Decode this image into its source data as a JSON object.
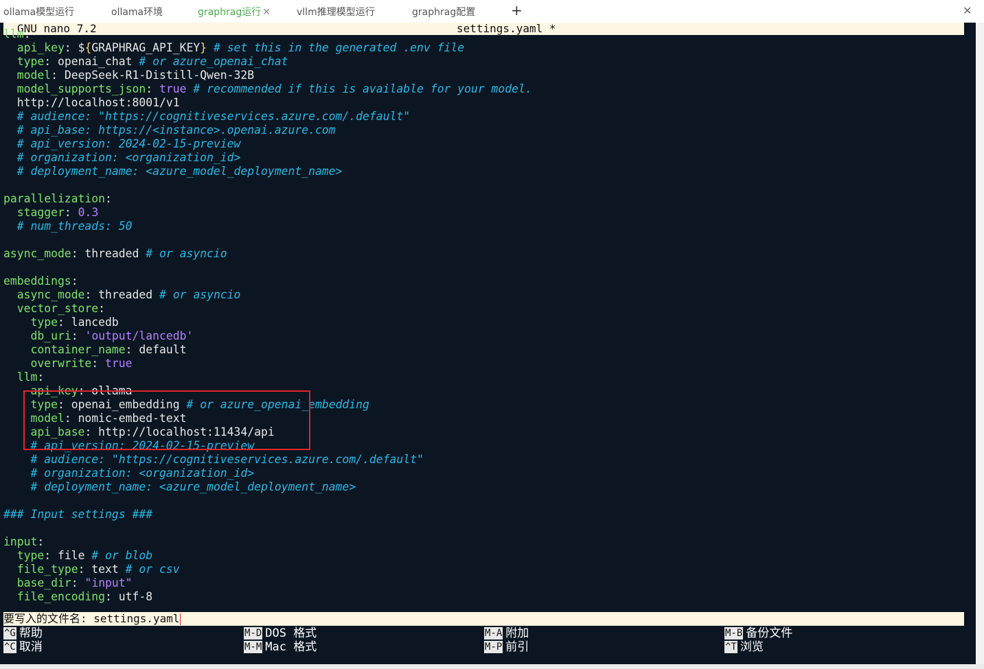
{
  "tabs": [
    {
      "label": "ollama模型运行",
      "active": false
    },
    {
      "label": "ollama环境",
      "active": false
    },
    {
      "label": "graphrag运行",
      "active": true,
      "close": "✕"
    },
    {
      "label": "vllm推理模型运行",
      "active": false
    },
    {
      "label": "graphrag配置",
      "active": false
    }
  ],
  "new_tab_label": "+",
  "window_close": "✕",
  "nano": {
    "version": "GNU nano 7.2",
    "filename": "settings.yaml *"
  },
  "editor_lines": [
    [
      {
        "t": "llm",
        "c": "k"
      },
      {
        "t": ":"
      }
    ],
    [
      {
        "t": "  "
      },
      {
        "t": "api_key",
        "c": "k"
      },
      {
        "t": ": $"
      },
      {
        "t": "{",
        "c": "p"
      },
      {
        "t": "GRAPHRAG_API_KEY"
      },
      {
        "t": "}",
        "c": "p"
      },
      {
        "t": " "
      },
      {
        "t": "# set this in the generated .env file",
        "c": "c"
      }
    ],
    [
      {
        "t": "  "
      },
      {
        "t": "type",
        "c": "k"
      },
      {
        "t": ": openai_chat "
      },
      {
        "t": "# or azure_openai_chat",
        "c": "c"
      }
    ],
    [
      {
        "t": "  "
      },
      {
        "t": "model",
        "c": "k"
      },
      {
        "t": ": DeepSeek-R1-Distill-Qwen-32B"
      }
    ],
    [
      {
        "t": "  "
      },
      {
        "t": "model_supports_json",
        "c": "k"
      },
      {
        "t": ": "
      },
      {
        "t": "true",
        "c": "v"
      },
      {
        "t": " "
      },
      {
        "t": "# recommended if this is available for your model.",
        "c": "c"
      }
    ],
    [
      {
        "t": "  http://localhost:8001/v1"
      }
    ],
    [
      {
        "t": "  "
      },
      {
        "t": "# audience: \"https://cognitiveservices.azure.com/.default\"",
        "c": "c"
      }
    ],
    [
      {
        "t": "  "
      },
      {
        "t": "# api_base: https://<instance>.openai.azure.com",
        "c": "c"
      }
    ],
    [
      {
        "t": "  "
      },
      {
        "t": "# api_version: 2024-02-15-preview",
        "c": "c"
      }
    ],
    [
      {
        "t": "  "
      },
      {
        "t": "# organization: <organization_id>",
        "c": "c"
      }
    ],
    [
      {
        "t": "  "
      },
      {
        "t": "# deployment_name: <azure_model_deployment_name>",
        "c": "c"
      }
    ],
    [],
    [
      {
        "t": "parallelization",
        "c": "k"
      },
      {
        "t": ":"
      }
    ],
    [
      {
        "t": "  "
      },
      {
        "t": "stagger",
        "c": "k"
      },
      {
        "t": ": "
      },
      {
        "t": "0.3",
        "c": "v"
      }
    ],
    [
      {
        "t": "  "
      },
      {
        "t": "# num_threads: 50",
        "c": "c"
      }
    ],
    [],
    [
      {
        "t": "async_mode",
        "c": "k"
      },
      {
        "t": ": threaded "
      },
      {
        "t": "# or asyncio",
        "c": "c"
      }
    ],
    [],
    [
      {
        "t": "embeddings",
        "c": "k"
      },
      {
        "t": ":"
      }
    ],
    [
      {
        "t": "  "
      },
      {
        "t": "async_mode",
        "c": "k"
      },
      {
        "t": ": threaded "
      },
      {
        "t": "# or asyncio",
        "c": "c"
      }
    ],
    [
      {
        "t": "  "
      },
      {
        "t": "vector_store",
        "c": "k"
      },
      {
        "t": ":"
      }
    ],
    [
      {
        "t": "    "
      },
      {
        "t": "type",
        "c": "k"
      },
      {
        "t": ": lancedb"
      }
    ],
    [
      {
        "t": "    "
      },
      {
        "t": "db_uri",
        "c": "k"
      },
      {
        "t": ": "
      },
      {
        "t": "'output/lancedb'",
        "c": "v"
      }
    ],
    [
      {
        "t": "    "
      },
      {
        "t": "container_name",
        "c": "k"
      },
      {
        "t": ": default"
      }
    ],
    [
      {
        "t": "    "
      },
      {
        "t": "overwrite",
        "c": "k"
      },
      {
        "t": ": "
      },
      {
        "t": "true",
        "c": "v"
      }
    ],
    [
      {
        "t": "  "
      },
      {
        "t": "llm",
        "c": "k"
      },
      {
        "t": ":"
      }
    ],
    [
      {
        "t": "    "
      },
      {
        "t": "api_key",
        "c": "k"
      },
      {
        "t": ": ollama"
      }
    ],
    [
      {
        "t": "    "
      },
      {
        "t": "type",
        "c": "k"
      },
      {
        "t": ": openai_embedding "
      },
      {
        "t": "# or azure_openai_embedding",
        "c": "c"
      }
    ],
    [
      {
        "t": "    "
      },
      {
        "t": "model",
        "c": "k"
      },
      {
        "t": ": nomic-embed-text"
      }
    ],
    [
      {
        "t": "    "
      },
      {
        "t": "api_base",
        "c": "k"
      },
      {
        "t": ": http://localhost:11434/api"
      }
    ],
    [
      {
        "t": "    "
      },
      {
        "t": "# api_version: 2024-02-15-preview",
        "c": "c"
      }
    ],
    [
      {
        "t": "    "
      },
      {
        "t": "# audience: \"https://cognitiveservices.azure.com/.default\"",
        "c": "c"
      }
    ],
    [
      {
        "t": "    "
      },
      {
        "t": "# organization: <organization_id>",
        "c": "c"
      }
    ],
    [
      {
        "t": "    "
      },
      {
        "t": "# deployment_name: <azure_model_deployment_name>",
        "c": "c"
      }
    ],
    [],
    [
      {
        "t": "### Input settings ###",
        "c": "c"
      }
    ],
    [],
    [
      {
        "t": "input",
        "c": "k"
      },
      {
        "t": ":"
      }
    ],
    [
      {
        "t": "  "
      },
      {
        "t": "type",
        "c": "k"
      },
      {
        "t": ": file "
      },
      {
        "t": "# or blob",
        "c": "c"
      }
    ],
    [
      {
        "t": "  "
      },
      {
        "t": "file_type",
        "c": "k"
      },
      {
        "t": ": text "
      },
      {
        "t": "# or csv",
        "c": "c"
      }
    ],
    [
      {
        "t": "  "
      },
      {
        "t": "base_dir",
        "c": "k"
      },
      {
        "t": ": "
      },
      {
        "t": "\"input\"",
        "c": "v"
      }
    ],
    [
      {
        "t": "  "
      },
      {
        "t": "file_encoding",
        "c": "k"
      },
      {
        "t": ": utf-8"
      }
    ]
  ],
  "prompt": {
    "label": "要写入的文件名: ",
    "value": "settings.yaml"
  },
  "shortcuts": [
    {
      "key": "^G",
      "label": "帮助"
    },
    {
      "key": "M-D",
      "label": "DOS 格式"
    },
    {
      "key": "M-A",
      "label": "附加"
    },
    {
      "key": "M-B",
      "label": "备份文件"
    },
    {
      "key": "^C",
      "label": "取消"
    },
    {
      "key": "M-M",
      "label": "Mac 格式"
    },
    {
      "key": "M-P",
      "label": "前引"
    },
    {
      "key": "^T",
      "label": "浏览"
    }
  ],
  "colors": {
    "terminal_bg": "#0b1622",
    "keyword": "#7ee36b",
    "comment": "#29b9e6",
    "value": "#b680ff",
    "highlight_box": "#e0262a",
    "active_tab": "#4caf50"
  }
}
